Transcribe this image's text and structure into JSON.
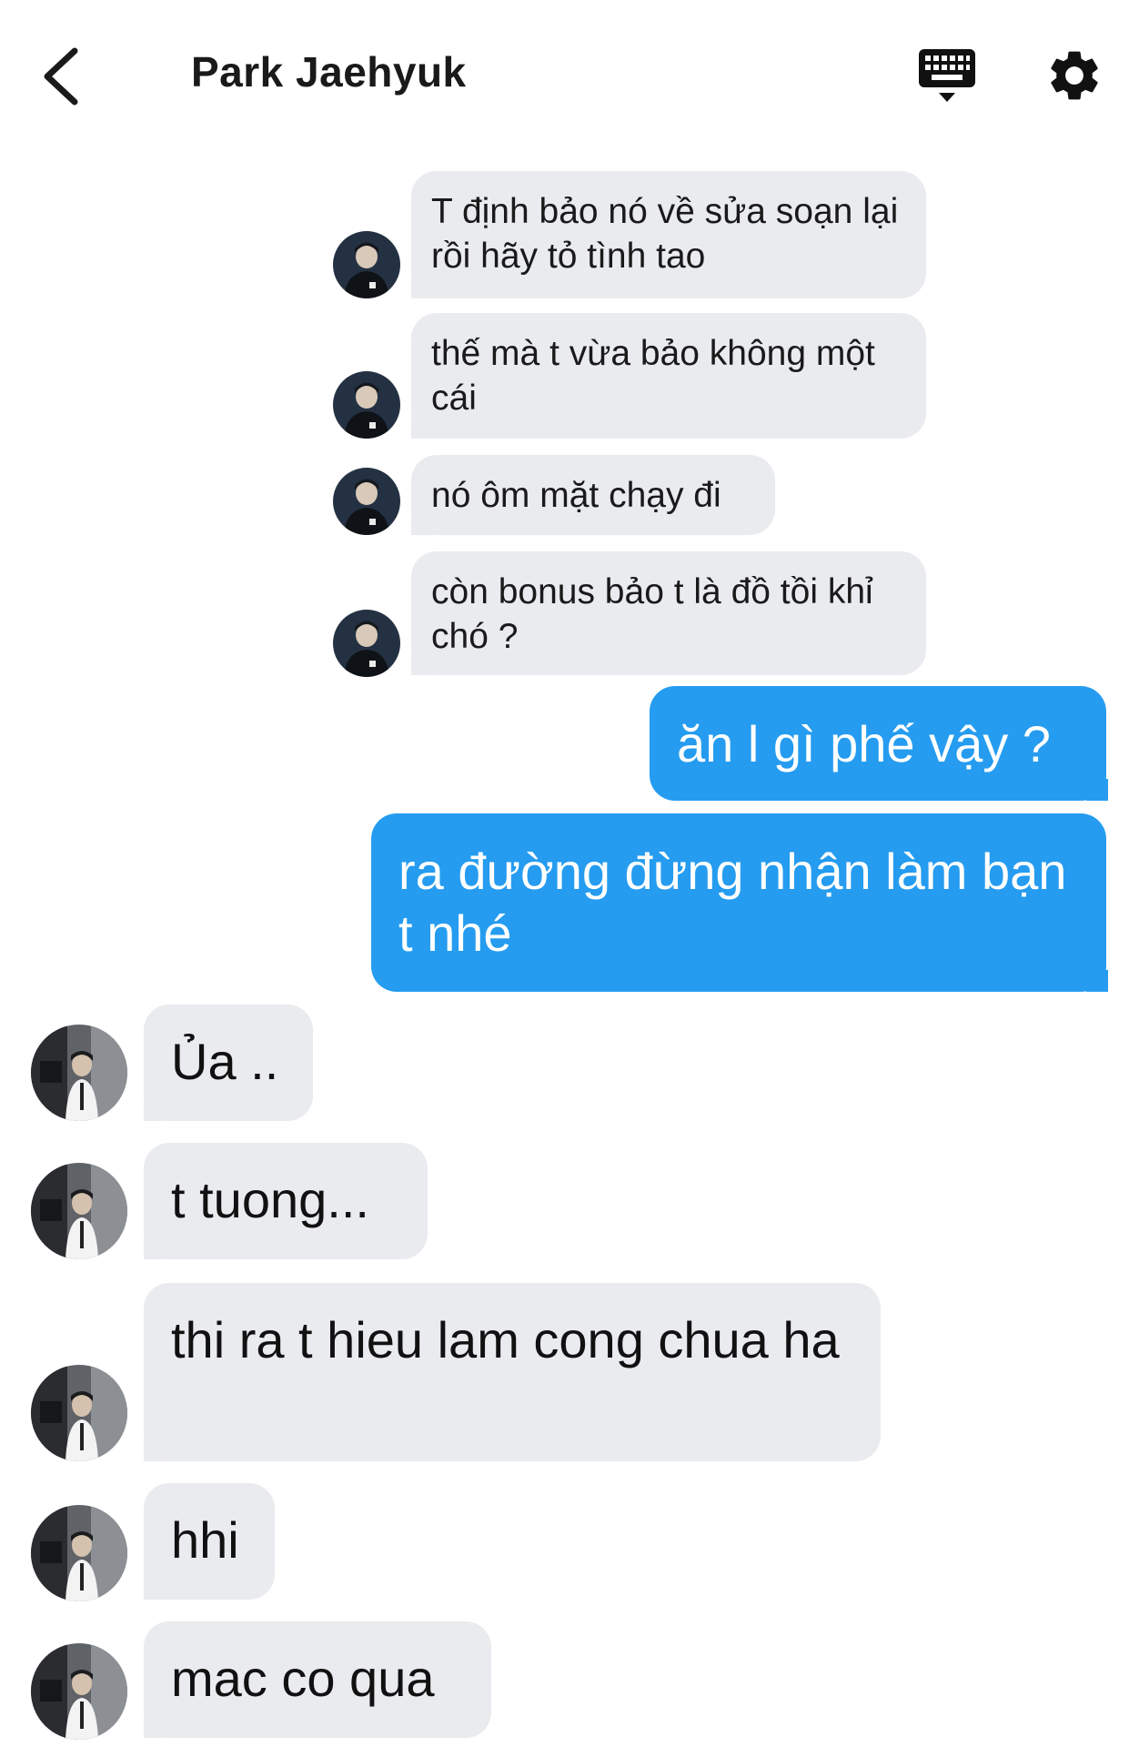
{
  "header": {
    "title": "Park Jaehyuk",
    "back_icon": "chevron-left-icon",
    "keyboard_icon": "keyboard-icon",
    "settings_icon": "gear-icon"
  },
  "colors": {
    "outgoing_bubble": "#259cf0",
    "incoming_bubble": "#e9ebee"
  },
  "messages": [
    {
      "sender": "other",
      "text": "T định bảo nó về sửa soạn lại rồi hãy tỏ tình tao"
    },
    {
      "sender": "other",
      "text": "thế mà t vừa bảo không một cái"
    },
    {
      "sender": "other",
      "text": "nó ôm mặt chạy đi"
    },
    {
      "sender": "other",
      "text": "còn bonus bảo t là đồ tồi khỉ chó ?"
    },
    {
      "sender": "me",
      "text": "ăn l gì phế vậy ?"
    },
    {
      "sender": "me",
      "text": "ra đường đừng nhận làm bạn t nhé"
    },
    {
      "sender": "other2",
      "text": "Ủa .."
    },
    {
      "sender": "other2",
      "text": "t tuong..."
    },
    {
      "sender": "other2",
      "text": "thi ra t hieu lam cong chua ha"
    },
    {
      "sender": "other2",
      "text": "hhi"
    },
    {
      "sender": "other2",
      "text": "mac co qua"
    }
  ]
}
